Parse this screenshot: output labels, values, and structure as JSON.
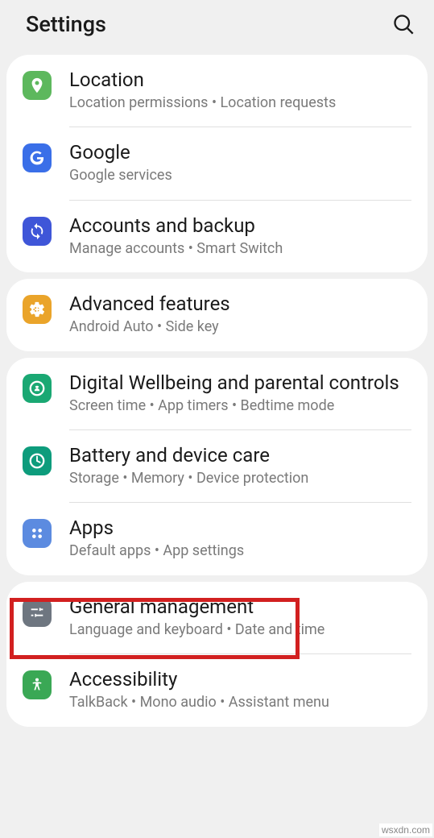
{
  "header": {
    "title": "Settings"
  },
  "groups": {
    "g1": {
      "location": {
        "title": "Location",
        "subtitle": "Location permissions  •  Location requests"
      },
      "google": {
        "title": "Google",
        "subtitle": "Google services"
      },
      "accounts": {
        "title": "Accounts and backup",
        "subtitle": "Manage accounts  •  Smart Switch"
      }
    },
    "g2": {
      "advanced": {
        "title": "Advanced features",
        "subtitle": "Android Auto  •  Side key"
      }
    },
    "g3": {
      "wellbeing": {
        "title": "Digital Wellbeing and parental controls",
        "subtitle": "Screen time  •  App timers  •  Bedtime mode"
      },
      "battery": {
        "title": "Battery and device care",
        "subtitle": "Storage  •  Memory  •  Device protection"
      },
      "apps": {
        "title": "Apps",
        "subtitle": "Default apps  •  App settings"
      }
    },
    "g4": {
      "general": {
        "title": "General management",
        "subtitle": "Language and keyboard  •  Date and time"
      },
      "accessibility": {
        "title": "Accessibility",
        "subtitle": "TalkBack  •  Mono audio  •  Assistant menu"
      }
    }
  },
  "watermark": "wsxdn.com"
}
